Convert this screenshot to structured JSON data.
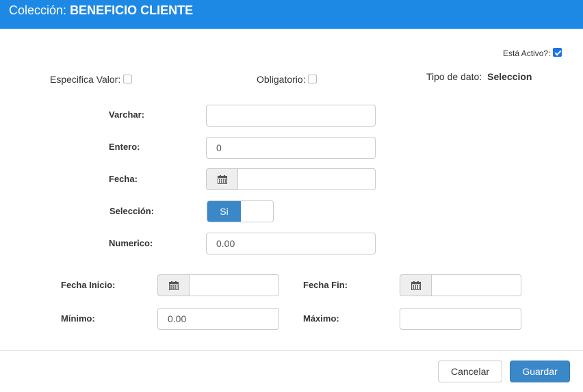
{
  "header": {
    "prefix": "Colección:",
    "name": "BENEFICIO CLIENTE"
  },
  "flags": {
    "esta_activo_label": "Está Activo?:",
    "esta_activo_checked": true,
    "especifica_valor_label": "Especifica Valor:",
    "especifica_valor_checked": false,
    "obligatorio_label": "Obligatorio:",
    "obligatorio_checked": false
  },
  "tipo_dato": {
    "label": "Tipo de dato:",
    "value": "Seleccion"
  },
  "fields": {
    "varchar": {
      "label": "Varchar:",
      "value": ""
    },
    "entero": {
      "label": "Entero:",
      "value": "0"
    },
    "fecha": {
      "label": "Fecha:",
      "value": ""
    },
    "seleccion": {
      "label": "Selección:",
      "on_label": "Si"
    },
    "numerico": {
      "label": "Numerico:",
      "value": "0.00"
    },
    "fecha_inicio": {
      "label": "Fecha Inicio:",
      "value": ""
    },
    "fecha_fin": {
      "label": "Fecha Fin:",
      "value": ""
    },
    "minimo": {
      "label": "Mínimo:",
      "value": "0.00"
    },
    "maximo": {
      "label": "Máximo:",
      "value": ""
    }
  },
  "icons": {
    "calendar": "calendar-icon",
    "check": "checkmark-icon"
  },
  "colors": {
    "header_bg": "#1e88e5",
    "primary": "#3b88c9",
    "addon_bg": "#eeeeee"
  },
  "buttons": {
    "cancel": "Cancelar",
    "save": "Guardar"
  }
}
